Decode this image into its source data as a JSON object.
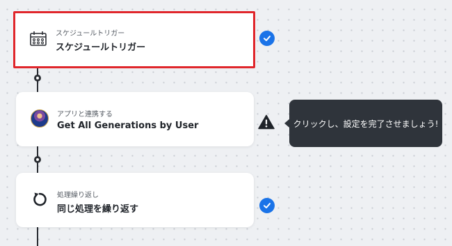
{
  "flow": {
    "steps": [
      {
        "subtitle": "スケジュールトリガー",
        "title": "スケジュールトリガー",
        "icon": "calendar-schedule-icon",
        "status": "complete",
        "selected": true
      },
      {
        "subtitle": "アプリと連携する",
        "title": "Get All Generations by User",
        "icon": "app-avatar-icon",
        "status": "warning",
        "selected": false
      },
      {
        "subtitle": "処理繰り返し",
        "title": "同じ処理を繰り返す",
        "icon": "loop-arrow-icon",
        "status": "complete",
        "selected": false
      }
    ]
  },
  "tooltip": {
    "text": "クリックし、設定を完了させましょう!"
  },
  "colors": {
    "selection_border": "#e0262b",
    "check_badge": "#1a73e8",
    "tooltip_bg": "#2f343b",
    "connector": "#2a2d33",
    "canvas_bg": "#eef0f3"
  }
}
